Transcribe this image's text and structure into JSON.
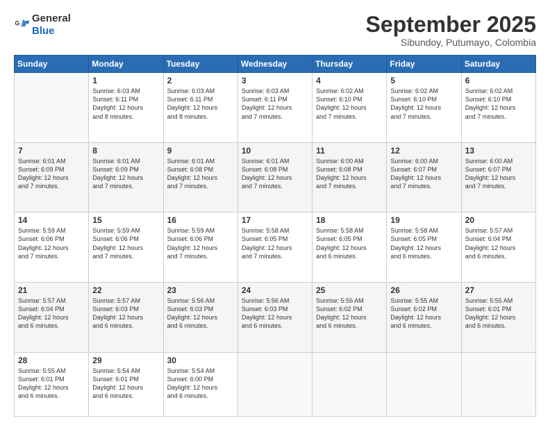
{
  "logo": {
    "text_general": "General",
    "text_blue": "Blue"
  },
  "header": {
    "month_title": "September 2025",
    "subtitle": "Sibundoy, Putumayo, Colombia"
  },
  "weekdays": [
    "Sunday",
    "Monday",
    "Tuesday",
    "Wednesday",
    "Thursday",
    "Friday",
    "Saturday"
  ],
  "weeks": [
    [
      {
        "day": "",
        "info": ""
      },
      {
        "day": "1",
        "info": "Sunrise: 6:03 AM\nSunset: 6:11 PM\nDaylight: 12 hours\nand 8 minutes."
      },
      {
        "day": "2",
        "info": "Sunrise: 6:03 AM\nSunset: 6:11 PM\nDaylight: 12 hours\nand 8 minutes."
      },
      {
        "day": "3",
        "info": "Sunrise: 6:03 AM\nSunset: 6:11 PM\nDaylight: 12 hours\nand 7 minutes."
      },
      {
        "day": "4",
        "info": "Sunrise: 6:02 AM\nSunset: 6:10 PM\nDaylight: 12 hours\nand 7 minutes."
      },
      {
        "day": "5",
        "info": "Sunrise: 6:02 AM\nSunset: 6:10 PM\nDaylight: 12 hours\nand 7 minutes."
      },
      {
        "day": "6",
        "info": "Sunrise: 6:02 AM\nSunset: 6:10 PM\nDaylight: 12 hours\nand 7 minutes."
      }
    ],
    [
      {
        "day": "7",
        "info": "Sunrise: 6:01 AM\nSunset: 6:09 PM\nDaylight: 12 hours\nand 7 minutes."
      },
      {
        "day": "8",
        "info": "Sunrise: 6:01 AM\nSunset: 6:09 PM\nDaylight: 12 hours\nand 7 minutes."
      },
      {
        "day": "9",
        "info": "Sunrise: 6:01 AM\nSunset: 6:08 PM\nDaylight: 12 hours\nand 7 minutes."
      },
      {
        "day": "10",
        "info": "Sunrise: 6:01 AM\nSunset: 6:08 PM\nDaylight: 12 hours\nand 7 minutes."
      },
      {
        "day": "11",
        "info": "Sunrise: 6:00 AM\nSunset: 6:08 PM\nDaylight: 12 hours\nand 7 minutes."
      },
      {
        "day": "12",
        "info": "Sunrise: 6:00 AM\nSunset: 6:07 PM\nDaylight: 12 hours\nand 7 minutes."
      },
      {
        "day": "13",
        "info": "Sunrise: 6:00 AM\nSunset: 6:07 PM\nDaylight: 12 hours\nand 7 minutes."
      }
    ],
    [
      {
        "day": "14",
        "info": "Sunrise: 5:59 AM\nSunset: 6:06 PM\nDaylight: 12 hours\nand 7 minutes."
      },
      {
        "day": "15",
        "info": "Sunrise: 5:59 AM\nSunset: 6:06 PM\nDaylight: 12 hours\nand 7 minutes."
      },
      {
        "day": "16",
        "info": "Sunrise: 5:59 AM\nSunset: 6:06 PM\nDaylight: 12 hours\nand 7 minutes."
      },
      {
        "day": "17",
        "info": "Sunrise: 5:58 AM\nSunset: 6:05 PM\nDaylight: 12 hours\nand 7 minutes."
      },
      {
        "day": "18",
        "info": "Sunrise: 5:58 AM\nSunset: 6:05 PM\nDaylight: 12 hours\nand 6 minutes."
      },
      {
        "day": "19",
        "info": "Sunrise: 5:58 AM\nSunset: 6:05 PM\nDaylight: 12 hours\nand 6 minutes."
      },
      {
        "day": "20",
        "info": "Sunrise: 5:57 AM\nSunset: 6:04 PM\nDaylight: 12 hours\nand 6 minutes."
      }
    ],
    [
      {
        "day": "21",
        "info": "Sunrise: 5:57 AM\nSunset: 6:04 PM\nDaylight: 12 hours\nand 6 minutes."
      },
      {
        "day": "22",
        "info": "Sunrise: 5:57 AM\nSunset: 6:03 PM\nDaylight: 12 hours\nand 6 minutes."
      },
      {
        "day": "23",
        "info": "Sunrise: 5:56 AM\nSunset: 6:03 PM\nDaylight: 12 hours\nand 6 minutes."
      },
      {
        "day": "24",
        "info": "Sunrise: 5:56 AM\nSunset: 6:03 PM\nDaylight: 12 hours\nand 6 minutes."
      },
      {
        "day": "25",
        "info": "Sunrise: 5:56 AM\nSunset: 6:02 PM\nDaylight: 12 hours\nand 6 minutes."
      },
      {
        "day": "26",
        "info": "Sunrise: 5:55 AM\nSunset: 6:02 PM\nDaylight: 12 hours\nand 6 minutes."
      },
      {
        "day": "27",
        "info": "Sunrise: 5:55 AM\nSunset: 6:01 PM\nDaylight: 12 hours\nand 6 minutes."
      }
    ],
    [
      {
        "day": "28",
        "info": "Sunrise: 5:55 AM\nSunset: 6:01 PM\nDaylight: 12 hours\nand 6 minutes."
      },
      {
        "day": "29",
        "info": "Sunrise: 5:54 AM\nSunset: 6:01 PM\nDaylight: 12 hours\nand 6 minutes."
      },
      {
        "day": "30",
        "info": "Sunrise: 5:54 AM\nSunset: 6:00 PM\nDaylight: 12 hours\nand 6 minutes."
      },
      {
        "day": "",
        "info": ""
      },
      {
        "day": "",
        "info": ""
      },
      {
        "day": "",
        "info": ""
      },
      {
        "day": "",
        "info": ""
      }
    ]
  ]
}
